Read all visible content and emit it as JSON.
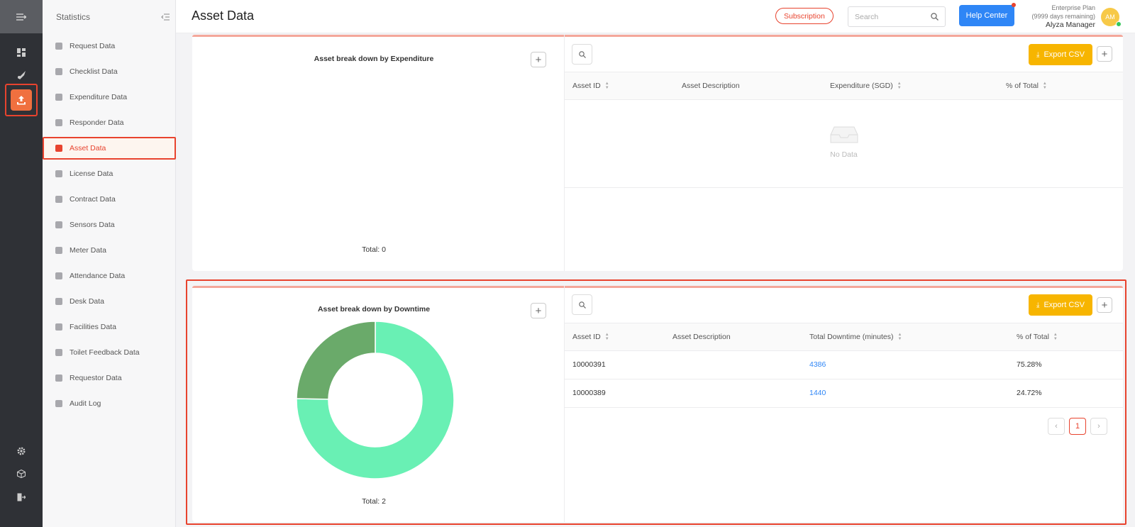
{
  "header": {
    "title": "Asset Data",
    "subscription_label": "Subscription",
    "search_placeholder": "Search",
    "help_label": "Help Center",
    "plan_name": "Enterprise Plan",
    "plan_days": "(9999 days remaining)",
    "user_name": "Alyza Manager",
    "avatar_initials": "AM"
  },
  "sidebar": {
    "title": "Statistics",
    "items": [
      {
        "label": "Request Data",
        "icon": "question-icon"
      },
      {
        "label": "Checklist Data",
        "icon": "checklist-icon"
      },
      {
        "label": "Expenditure Data",
        "icon": "wallet-icon"
      },
      {
        "label": "Responder Data",
        "icon": "users-icon"
      },
      {
        "label": "Asset Data",
        "icon": "box-icon"
      },
      {
        "label": "License Data",
        "icon": "shield-icon"
      },
      {
        "label": "Contract Data",
        "icon": "document-icon"
      },
      {
        "label": "Sensors Data",
        "icon": "rss-icon"
      },
      {
        "label": "Meter Data",
        "icon": "gauge-icon"
      },
      {
        "label": "Attendance Data",
        "icon": "check-square-icon"
      },
      {
        "label": "Desk Data",
        "icon": "desk-icon"
      },
      {
        "label": "Facilities Data",
        "icon": "calendar-icon"
      },
      {
        "label": "Toilet Feedback Data",
        "icon": "list-icon"
      },
      {
        "label": "Requestor Data",
        "icon": "smile-icon"
      },
      {
        "label": "Audit Log",
        "icon": "log-icon"
      }
    ],
    "active_index": 4
  },
  "expenditure": {
    "chart_title": "Asset break down by Expenditure",
    "total": "Total: 0",
    "export_label": "Export CSV",
    "columns": [
      "Asset ID",
      "Asset Description",
      "Expenditure (SGD)",
      "% of Total"
    ],
    "empty_text": "No Data"
  },
  "downtime": {
    "chart_title": "Asset break down by Downtime",
    "total": "Total: 2",
    "export_label": "Export CSV",
    "columns": [
      "Asset ID",
      "Asset Description",
      "Total Downtime (minutes)",
      "% of Total"
    ],
    "rows": [
      {
        "asset_id": "10000391",
        "description": "",
        "downtime": "4386",
        "percent": "75.28%"
      },
      {
        "asset_id": "10000389",
        "description": "",
        "downtime": "1440",
        "percent": "24.72%"
      }
    ],
    "page": "1"
  },
  "chart_data": {
    "type": "pie",
    "donut": true,
    "labels": [
      "10000391",
      "10000389"
    ],
    "values": [
      4386,
      1440
    ],
    "colors": [
      "#69f0b4",
      "#6aaa6a"
    ]
  },
  "colors": {
    "accent": "#e8432e",
    "export": "#f7b500",
    "help": "#2f86f6"
  }
}
